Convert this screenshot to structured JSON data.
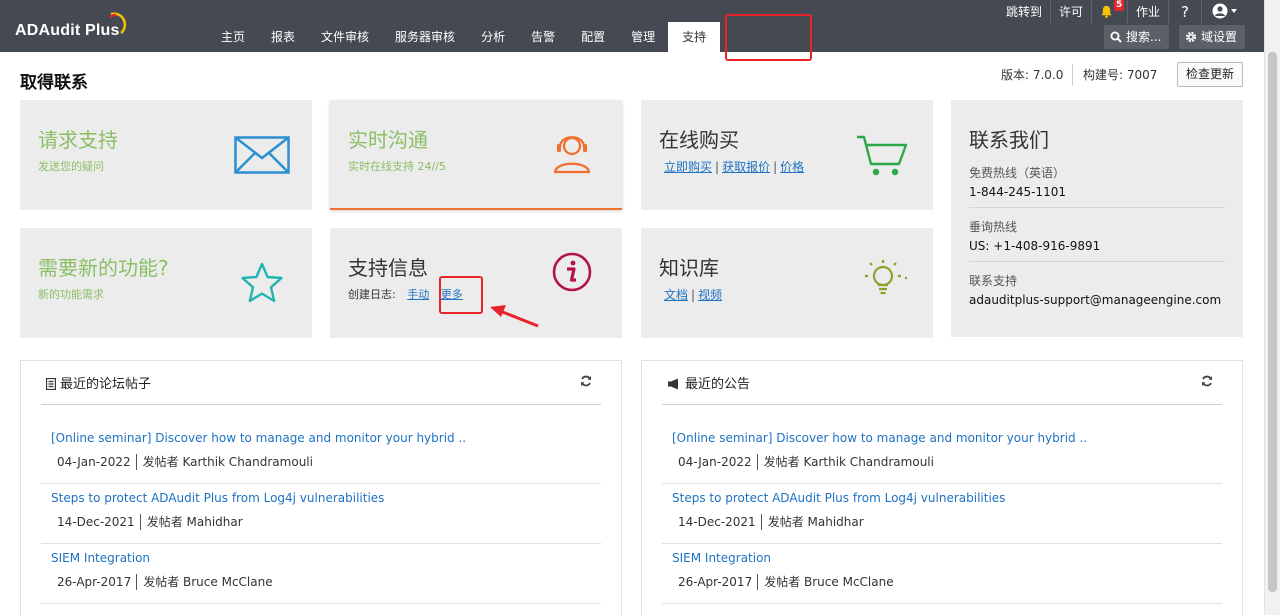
{
  "app": {
    "logo_text": "ADAudit Plus"
  },
  "nav": {
    "tabs": [
      "主页",
      "报表",
      "文件审核",
      "服务器审核",
      "分析",
      "告警",
      "配置",
      "管理",
      "支持"
    ],
    "active": "支持"
  },
  "utility": {
    "jump": "跳转到",
    "license": "许可",
    "notification_count": "5",
    "jobs": "作业",
    "help": "?",
    "search_label": "搜索...",
    "domain_settings": "域设置"
  },
  "page": {
    "title": "取得联系",
    "version_label": "版本: 7.0.0",
    "build_label": "构建号: 7007",
    "check_update": "检查更新"
  },
  "cards": {
    "request_support": {
      "title": "请求支持",
      "subtitle": "发送您的疑问"
    },
    "live_chat": {
      "title": "实时沟通",
      "subtitle": "实时在线支持 24//5"
    },
    "buy_online": {
      "title": "在线购买",
      "links": [
        "立即购买",
        "获取报价",
        "价格"
      ]
    },
    "new_feature": {
      "title": "需要新的功能?",
      "subtitle": "新的功能需求"
    },
    "support_info": {
      "title": "支持信息",
      "log_label": "创建日志:",
      "manual_link": "手动",
      "more_link": "更多"
    },
    "knowledge_base": {
      "title": "知识库",
      "links": [
        "文档",
        "视频"
      ]
    }
  },
  "contact": {
    "title": "联系我们",
    "tollfree_label": "免费热线（英语）",
    "tollfree_value": "1-844-245-1101",
    "direct_label": "垂询热线",
    "direct_value": "US: +1-408-916-9891",
    "email_label": "联系支持",
    "email_value": "adauditplus-support@manageengine.com"
  },
  "forum": {
    "title": "最近的论坛帖子",
    "posts": [
      {
        "title": "[Online seminar] Discover how to manage and monitor your hybrid ..",
        "date": "04-Jan-2022",
        "author": "发帖者 Karthik Chandramouli"
      },
      {
        "title": "Steps to protect ADAudit Plus from Log4j vulnerabilities",
        "date": "14-Dec-2021",
        "author": "发帖者 Mahidhar"
      },
      {
        "title": "SIEM Integration",
        "date": "26-Apr-2017",
        "author": "发帖者 Bruce McClane"
      }
    ]
  },
  "announcements": {
    "title": "最近的公告",
    "posts": [
      {
        "title": "[Online seminar] Discover how to manage and monitor your hybrid ..",
        "date": "04-Jan-2022",
        "author": "发帖者 Karthik Chandramouli"
      },
      {
        "title": "Steps to protect ADAudit Plus from Log4j vulnerabilities",
        "date": "14-Dec-2021",
        "author": "发帖者 Mahidhar"
      },
      {
        "title": "SIEM Integration",
        "date": "26-Apr-2017",
        "author": "发帖者 Bruce McClane"
      }
    ]
  },
  "colors": {
    "header_bg": "#454a52",
    "accent_green": "#8bbf65",
    "link_blue": "#1e72c2",
    "highlight_red": "#e8232a",
    "chat_orange": "#f07030"
  }
}
